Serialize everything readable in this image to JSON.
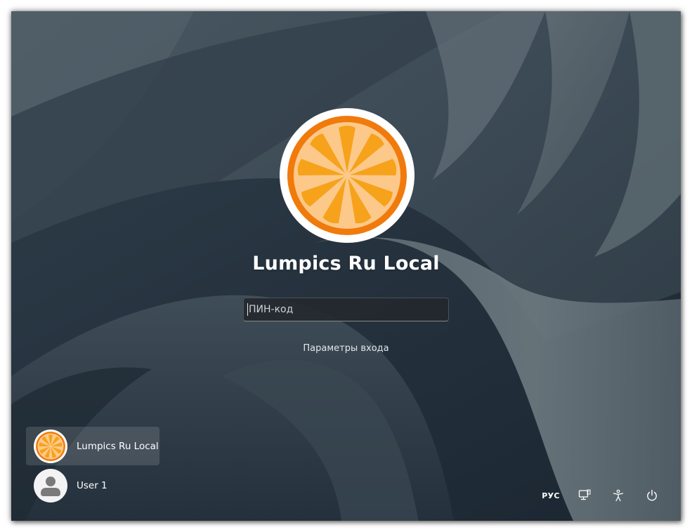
{
  "screen": "windows-11-lock-sign-in",
  "colors": {
    "orange_ring": "#f07a0c",
    "orange_flesh": "#fdc98a",
    "orange_segment": "#f6a21b",
    "text": "#ffffff"
  },
  "current_user": {
    "name": "Lumpics Ru Local",
    "avatar": "orange-slice-avatar"
  },
  "pin_field": {
    "placeholder": "ПИН-код",
    "value": ""
  },
  "sign_in_options_label": "Параметры входа",
  "user_list": [
    {
      "name": "Lumpics Ru Local",
      "avatar": "orange-slice-avatar",
      "selected": true
    },
    {
      "name": "User 1",
      "avatar": "default-person-avatar",
      "selected": false
    }
  ],
  "tray": {
    "language": "РУС",
    "icons": [
      "network-icon",
      "accessibility-icon",
      "power-icon"
    ]
  }
}
